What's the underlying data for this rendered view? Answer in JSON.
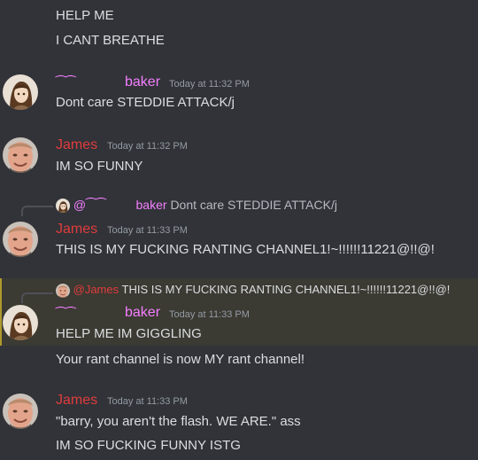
{
  "messages": {
    "m0": {
      "lines": [
        "HELP ME",
        "I CANT BREATHE"
      ]
    },
    "m1": {
      "author": "baker",
      "deco": "⁀⁀",
      "timestamp": "Today at 11:32 PM",
      "text": "Dont care STEDDIE ATTACK/j"
    },
    "m2": {
      "author": "James",
      "timestamp": "Today at 11:32 PM",
      "text": "IM SO FUNNY"
    },
    "m3": {
      "reply": {
        "prefix": "@",
        "deco": "⁀⁀",
        "author": "baker",
        "text": "Dont care STEDDIE ATTACK/j"
      },
      "author": "James",
      "timestamp": "Today at 11:33 PM",
      "text": "THIS IS MY FUCKING RANTING CHANNEL1!~!!!!!!11221@!!@!"
    },
    "m4": {
      "reply": {
        "author": "@James",
        "text": "THIS IS MY FUCKING RANTING CHANNEL1!~!!!!!!11221@!!@!"
      },
      "author": "baker",
      "deco": "⁀⁀",
      "timestamp": "Today at 11:33 PM",
      "text": "HELP ME IM GIGGLING",
      "followup": "Your rant channel is now MY rant channel!"
    },
    "m5": {
      "author": "James",
      "timestamp": "Today at 11:33 PM",
      "lines": [
        "\"barry, you aren't the flash. WE ARE.\" ass",
        "IM SO FUCKING FUNNY ISTG"
      ]
    }
  },
  "colors": {
    "background": "#313338",
    "baker_name": "#f47fff",
    "james_name": "#e03c3c",
    "highlight_bg": "#3b3a33",
    "highlight_bar": "#b0992e"
  },
  "icons": {
    "baker_avatar": "anime-girl-avatar",
    "james_avatar": "man-face-avatar"
  }
}
